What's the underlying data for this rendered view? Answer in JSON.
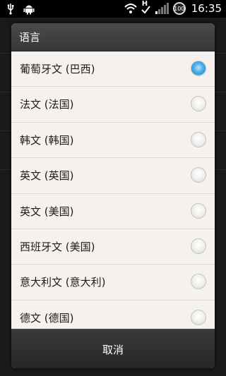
{
  "status_bar": {
    "time": "16:35",
    "battery_level": "100",
    "network_type": "H",
    "icons": [
      "usb-icon",
      "android-debug-icon",
      "wifi-icon",
      "data-sync-icon",
      "signal-icon",
      "battery-icon"
    ]
  },
  "dialog": {
    "title": "语言",
    "items": [
      {
        "label": "葡萄牙文 (巴西)",
        "selected": true
      },
      {
        "label": "法文 (法国)",
        "selected": false
      },
      {
        "label": "韩文 (韩国)",
        "selected": false
      },
      {
        "label": "英文 (英国)",
        "selected": false
      },
      {
        "label": "英文 (美国)",
        "selected": false
      },
      {
        "label": "西班牙文 (美国)",
        "selected": false
      },
      {
        "label": "意大利文 (意大利)",
        "selected": false
      },
      {
        "label": "德文 (德国)",
        "selected": false
      }
    ],
    "cancel_label": "取消"
  },
  "colors": {
    "accent": "#3fa6e3",
    "dialog_background": "#f2efea",
    "header_background": "#404040"
  }
}
